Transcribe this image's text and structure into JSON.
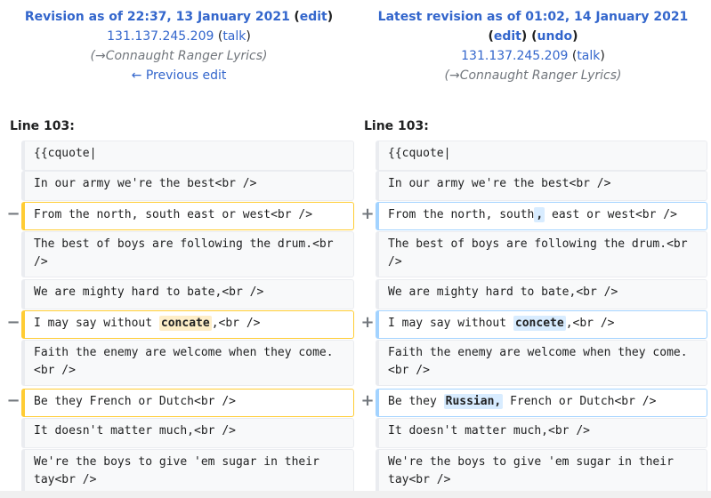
{
  "left_header": {
    "title": "Revision as of 22:37, 13 January 2021",
    "edit": "edit",
    "user": "131.137.245.209",
    "talk": "talk",
    "summary": "Connaught Ranger Lyrics",
    "prev": "← Previous edit"
  },
  "right_header": {
    "title": "Latest revision as of 01:02, 14 January 2021",
    "edit": "edit",
    "undo": "undo",
    "user": "131.137.245.209",
    "talk": "talk",
    "summary": "Connaught Ranger Lyrics"
  },
  "line_label": "Line 103:",
  "markers": {
    "del": "−",
    "add": "+"
  },
  "rows": [
    {
      "left": "{{cquote|",
      "right": "{{cquote|"
    },
    {
      "left": "In our army we're the best<br />",
      "right": "In our army we're the best<br />"
    },
    {
      "left": "From the north, south east or west<br />",
      "right_a": "From the north, south",
      "right_hl": ",",
      "right_b": " east or west<br />"
    },
    {
      "left": "The best of boys are following the drum.<br />",
      "right": "The best of boys are following the drum.<br />"
    },
    {
      "left": "We are mighty hard to bate,<br />",
      "right": "We are mighty hard to bate,<br />"
    },
    {
      "left_a": "I may say without ",
      "left_hl": "concate",
      "left_b": ",<br />",
      "right_a": "I may say without ",
      "right_hl": "concete",
      "right_b": ",<br />"
    },
    {
      "left": "Faith the enemy are welcome when they come.<br />",
      "right": "Faith the enemy are welcome when they come.<br />"
    },
    {
      "left": "Be they French or Dutch<br />",
      "right_a": "Be they ",
      "right_hl": "Russian,",
      "right_b": " French or Dutch<br />"
    },
    {
      "left": "It doesn't matter much,<br />",
      "right": "It doesn't matter much,<br />"
    },
    {
      "left": "We're the boys to give 'em sugar in their tay<br />",
      "right": "We're the boys to give 'em sugar in their tay<br />"
    }
  ]
}
